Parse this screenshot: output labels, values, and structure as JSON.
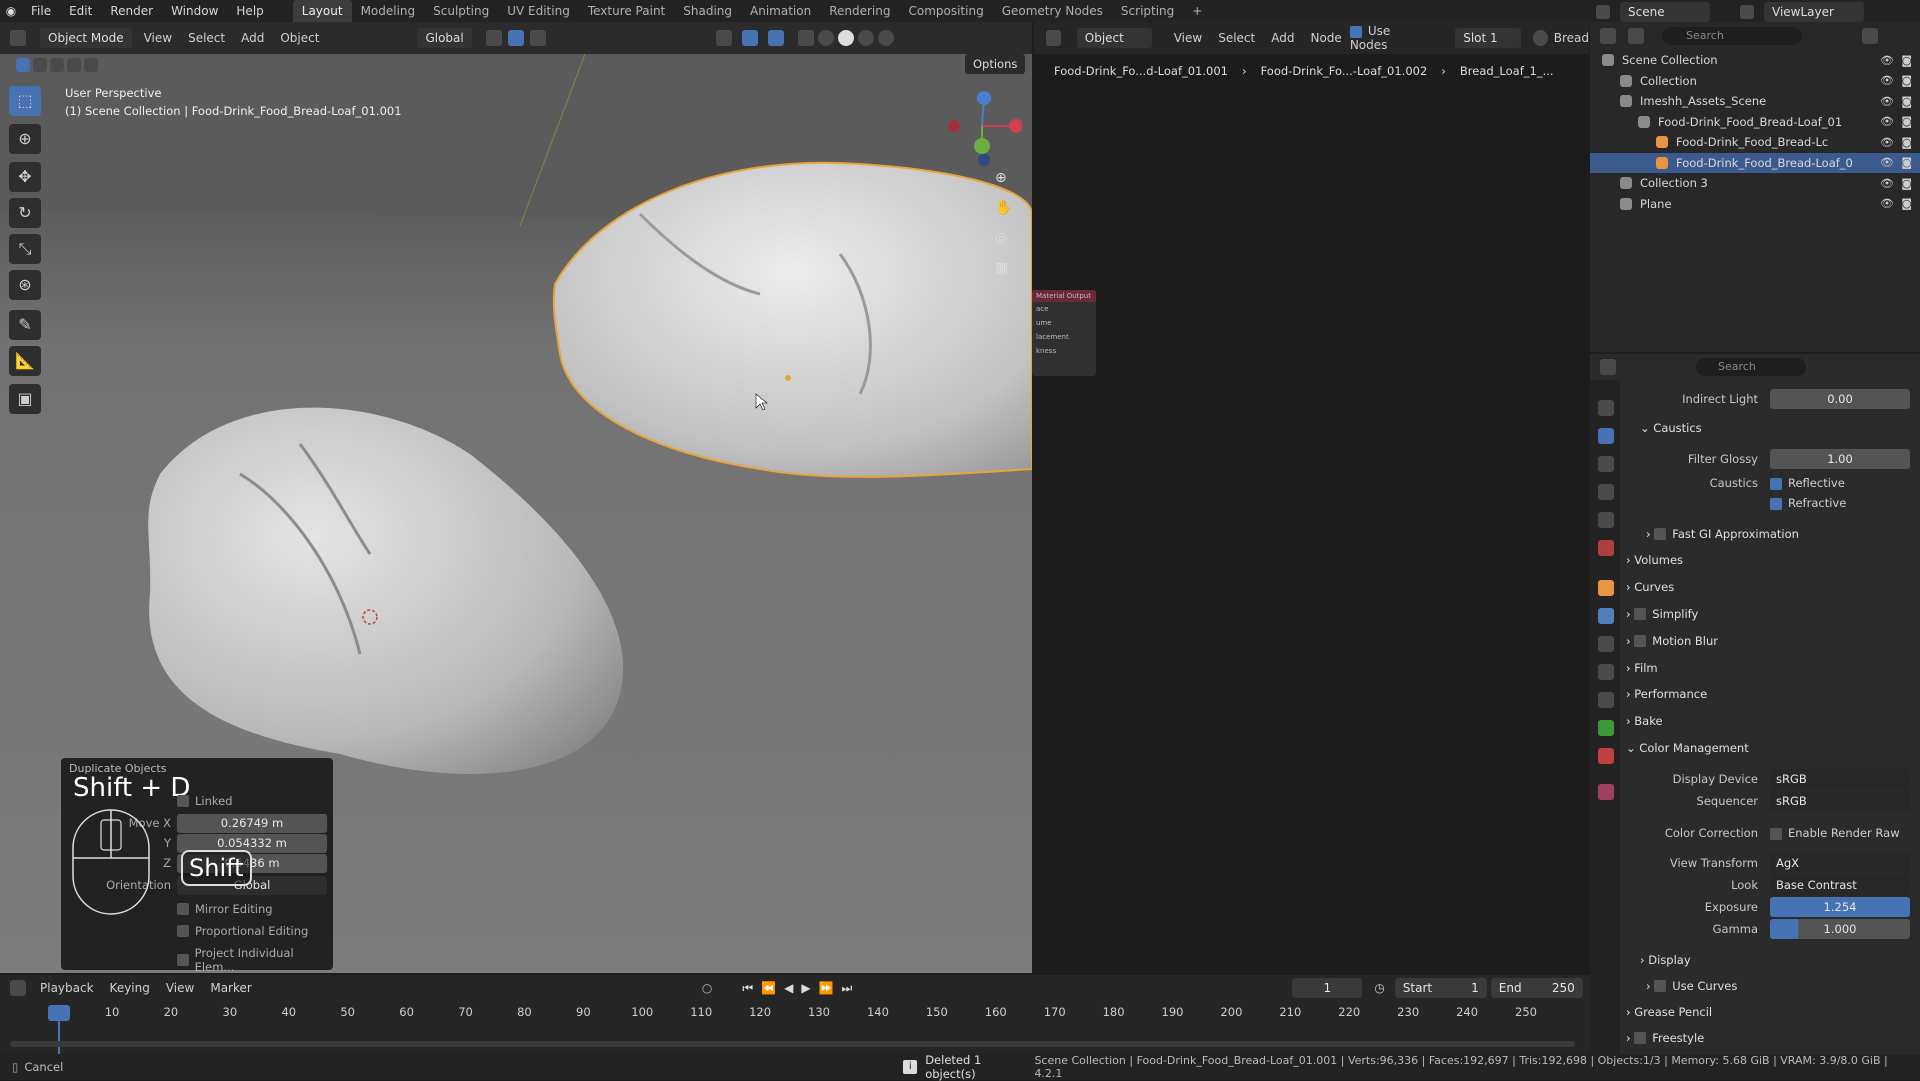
{
  "menu": [
    "File",
    "Edit",
    "Render",
    "Window",
    "Help"
  ],
  "workspaces": [
    "Layout",
    "Modeling",
    "Sculpting",
    "UV Editing",
    "Texture Paint",
    "Shading",
    "Animation",
    "Rendering",
    "Compositing",
    "Geometry Nodes",
    "Scripting",
    "+"
  ],
  "scene": "Scene",
  "viewlayer": "ViewLayer",
  "viewport": {
    "mode": "Object Mode",
    "menus": [
      "View",
      "Select",
      "Add",
      "Object"
    ],
    "orientation": "Global",
    "options": "Options",
    "perspective": "User Perspective",
    "context": "(1) Scene Collection | Food-Drink_Food_Bread-Loaf_01.001",
    "mini_node_title": "Material Output",
    "mini_node_rows": [
      "ace",
      "ume",
      "lacement",
      "kness"
    ]
  },
  "dup": {
    "title": "Duplicate Objects",
    "overlay": "Shift + D",
    "shift": "Shift",
    "linked": "Linked",
    "move_x_label": "Move X",
    "y_label": "Y",
    "z_label": "Z",
    "x": "0.26749 m",
    "y": "0.054332 m",
    "z": "0.5436 m",
    "orientation_label": "Orientation",
    "orientation": "Global",
    "mirror": "Mirror Editing",
    "proportional": "Proportional Editing",
    "project": "Project Individual Elem..."
  },
  "node": {
    "object": "Object",
    "menus": [
      "View",
      "Select",
      "Add",
      "Node"
    ],
    "use_nodes": "Use Nodes",
    "slot": "Slot 1",
    "material": "Bread",
    "breadcrumb": [
      "Food-Drink_Fo...d-Loaf_01.001",
      "Food-Drink_Fo...-Loaf_01.002",
      "Bread_Loaf_1_..."
    ]
  },
  "outliner": {
    "search": "Search",
    "rows": [
      {
        "label": "Scene Collection",
        "indent": 0
      },
      {
        "label": "Collection",
        "indent": 1
      },
      {
        "label": "Imeshh_Assets_Scene",
        "indent": 1
      },
      {
        "label": "Food-Drink_Food_Bread-Loaf_01",
        "indent": 2
      },
      {
        "label": "Food-Drink_Food_Bread-Lc",
        "indent": 3
      },
      {
        "label": "Food-Drink_Food_Bread-Loaf_0",
        "indent": 3,
        "selected": true
      },
      {
        "label": "Collection 3",
        "indent": 1
      },
      {
        "label": "Plane",
        "indent": 1
      }
    ]
  },
  "props": {
    "search": "Search",
    "indirect_light": "Indirect Light",
    "indirect_val": "0.00",
    "caustics": "Caustics",
    "filter_glossy": "Filter Glossy",
    "filter_val": "1.00",
    "caustics_lbl": "Caustics",
    "reflective": "Reflective",
    "refractive": "Refractive",
    "fast_gi": "Fast GI Approximation",
    "volumes": "Volumes",
    "curves": "Curves",
    "simplify": "Simplify",
    "motion_blur": "Motion Blur",
    "film": "Film",
    "performance": "Performance",
    "bake": "Bake",
    "color_mgmt": "Color Management",
    "display_device": "Display Device",
    "display_val": "sRGB",
    "sequencer": "Sequencer",
    "sequencer_val": "sRGB",
    "color_correction": "Color Correction",
    "render_raw": "Enable Render Raw",
    "view_transform": "View Transform",
    "view_transform_val": "AgX",
    "look": "Look",
    "look_val": "Base Contrast",
    "exposure": "Exposure",
    "exposure_val": "1.254",
    "gamma": "Gamma",
    "gamma_val": "1.000",
    "display": "Display",
    "use_curves": "Use Curves",
    "grease_pencil": "Grease Pencil",
    "freestyle": "Freestyle"
  },
  "timeline": {
    "menus": [
      "Playback",
      "Keying",
      "View",
      "Marker"
    ],
    "current": "1",
    "start_label": "Start",
    "start": "1",
    "end_label": "End",
    "end": "250",
    "ticks": [
      "1",
      "10",
      "20",
      "30",
      "40",
      "50",
      "60",
      "70",
      "80",
      "90",
      "100",
      "110",
      "120",
      "130",
      "140",
      "150",
      "160",
      "170",
      "180",
      "190",
      "200",
      "210",
      "220",
      "230",
      "240",
      "250"
    ]
  },
  "status": {
    "cancel": "Cancel",
    "message": "Deleted 1 object(s)",
    "info": "Scene Collection | Food-Drink_Food_Bread-Loaf_01.001 | Verts:96,336 | Faces:192,697 | Tris:192,698 | Objects:1/3 | Memory: 5.68 GiB | VRAM: 3.9/8.0 GiB | 4.2.1"
  },
  "colors": {
    "accent": "#4772b3",
    "selected_outline": "#e8a33a"
  }
}
